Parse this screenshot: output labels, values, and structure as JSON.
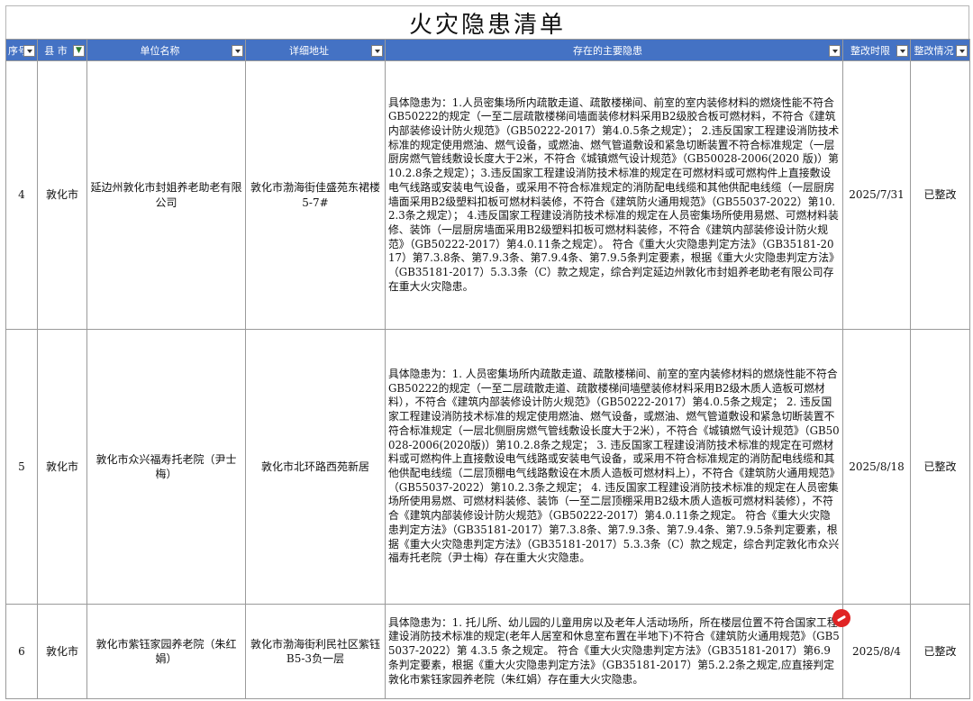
{
  "title": "火灾隐患清单",
  "columns": {
    "seq": "序号",
    "county": "县 市",
    "unit": "单位名称",
    "address": "详细地址",
    "issue": "存在的主要隐患",
    "deadline": "整改时限",
    "status": "整改情况"
  },
  "rows": [
    {
      "seq": "4",
      "county": "敦化市",
      "unit": "延边州敦化市封姐养老助老有限公司",
      "address": "敦化市渤海街佳盛苑东裙楼5-7#",
      "issue": "具体隐患为：1.人员密集场所内疏散走道、疏散楼梯间、前室的室内装修材料的燃烧性能不符合GB50222的规定（一至二层疏散楼梯间墙面装修材料采用B2级胶合板可燃材料，不符合《建筑内部装修设计防火规范》（GB50222-2017）第4.0.5条之规定）；  2.违反国家工程建设消防技术标准的规定使用燃油、燃气设备，或燃油、燃气管道敷设和紧急切断装置不符合标准规定（一层厨房燃气管线敷设长度大于2米，不符合《城镇燃气设计规范》（GB50028-2006(2020 版)）第10.2.8条之规定）；3.违反国家工程建设消防技术标准的规定在可燃材料或可燃构件上直接敷设电气线路或安装电气设备，或采用不符合标准规定的消防配电线缆和其他供配电线缆（一层厨房墙面采用B2级塑料扣板可燃材料装修，不符合《建筑防火通用规范》（GB55037-2022）第10.2.3条之规定）；  4.违反国家工程建设消防技术标准的规定在人员密集场所使用易燃、可燃材料装修、装饰（一层厨房墙面采用B2级塑料扣板可燃材料装修，不符合《建筑内部装修设计防火规范》（GB50222-2017）第4.0.11条之规定）。  符合《重大火灾隐患判定方法》（GB35181-2017）第7.3.8条、第7.9.3条、第7.9.4条、第7.9.5条判定要素，根据《重大火灾隐患判定方法》（GB35181-2017）5.3.3条（C）款之规定，综合判定延边州敦化市封姐养老助老有限公司存在重大火灾隐患。",
      "deadline": "2025/7/31",
      "status": "已整改"
    },
    {
      "seq": "5",
      "county": "敦化市",
      "unit": "敦化市众兴福寿托老院（尹士梅）",
      "address": "敦化市北环路西苑新居",
      "issue": "具体隐患为：1. 人员密集场所内疏散走道、疏散楼梯间、前室的室内装修材料的燃烧性能不符合GB50222的规定（一至二层疏散走道、疏散楼梯间墙壁装修材料采用B2级木质人造板可燃材料），不符合《建筑内部装修设计防火规范》（GB50222-2017）第4.0.5条之规定；  2. 违反国家工程建设消防技术标准的规定使用燃油、燃气设备，或燃油、燃气管道敷设和紧急切断装置不符合标准规定（一层北侧厨房燃气管线敷设长度大于2米），不符合《城镇燃气设计规范》（GB50028-2006(2020版)）第10.2.8条之规定；  3. 违反国家工程建设消防技术标准的规定在可燃材料或可燃构件上直接敷设电气线路或安装电气设备，或采用不符合标准规定的消防配电线缆和其他供配电线缆（二层顶棚电气线路敷设在木质人造板可燃材料上），不符合《建筑防火通用规范》（GB55037-2022）第10.2.3条之规定；  4. 违反国家工程建设消防技术标准的规定在人员密集场所使用易燃、可燃材料装修、装饰（一至二层顶棚采用B2级木质人造板可燃材料装修），不符合《建筑内部装修设计防火规范》（GB50222-2017）第4.0.11条之规定。  符合《重大火灾隐患判定方法》（GB35181-2017）第7.3.8条、第7.9.3条、第7.9.4条、第7.9.5条判定要素，根据《重大火灾隐患判定方法》（GB35181-2017）5.3.3条（C）款之规定，综合判定敦化市众兴福寿托老院（尹士梅）存在重大火灾隐患。",
      "deadline": "2025/8/18",
      "status": "已整改"
    },
    {
      "seq": "6",
      "county": "敦化市",
      "unit": "敦化市紫钰家园养老院（朱红娟）",
      "address": "敦化市渤海街利民社区紫钰B5-3负一层",
      "issue": "具体隐患为：1. 托儿所、幼儿园的儿童用房以及老年人活动场所，所在楼层位置不符合国家工程建设消防技术标准的规定(老年人居室和休息室布置在半地下)不符合《建筑防火通用规范》（GB55037-2022）第 4.3.5 条之规定。  符合《重大火灾隐患判定方法》（GB35181-2017）第6.9条判定要素，根据《重大火灾隐患判定方法》（GB35181-2017）第5.2.2条之规定,应直接判定敦化市紫钰家园养老院（朱红娟）存在重大火灾隐患。",
      "deadline": "2025/8/4",
      "status": "已整改"
    }
  ]
}
